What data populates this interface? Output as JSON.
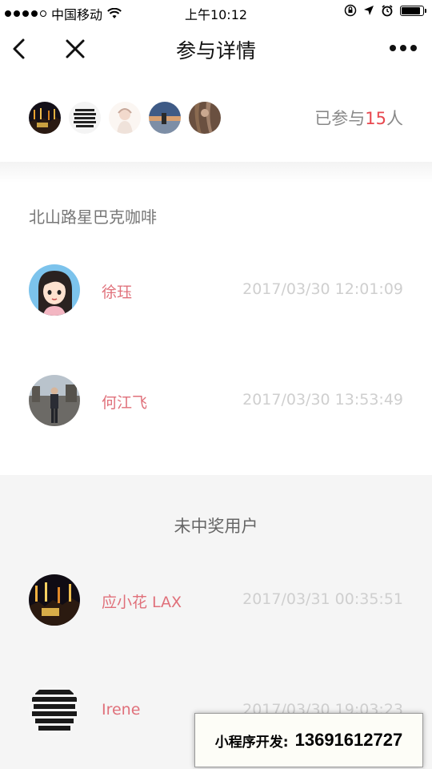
{
  "status_bar": {
    "carrier": "中国移动",
    "time": "上午10:12",
    "battery_level": 0.9
  },
  "nav": {
    "title": "参与详情"
  },
  "participants": {
    "prefix": "已参与",
    "count": "15",
    "suffix": "人"
  },
  "winners": {
    "store_name": "北山路星巴克咖啡",
    "items": [
      {
        "name": "徐珏",
        "time": "2017/03/30 12:01:09"
      },
      {
        "name": "何江飞",
        "time": "2017/03/30 13:53:49"
      }
    ]
  },
  "losers": {
    "title": "未中奖用户",
    "items": [
      {
        "name": "应小花 LAX",
        "time": "2017/03/31 00:35:51"
      },
      {
        "name": "Irene",
        "time": "2017/03/30 19:03:23"
      }
    ]
  },
  "promo": {
    "label": "小程序开发:",
    "phone": "13691612727"
  },
  "colors": {
    "accent": "#e8484f",
    "name": "#e0707a",
    "time": "#cfcfcf"
  }
}
